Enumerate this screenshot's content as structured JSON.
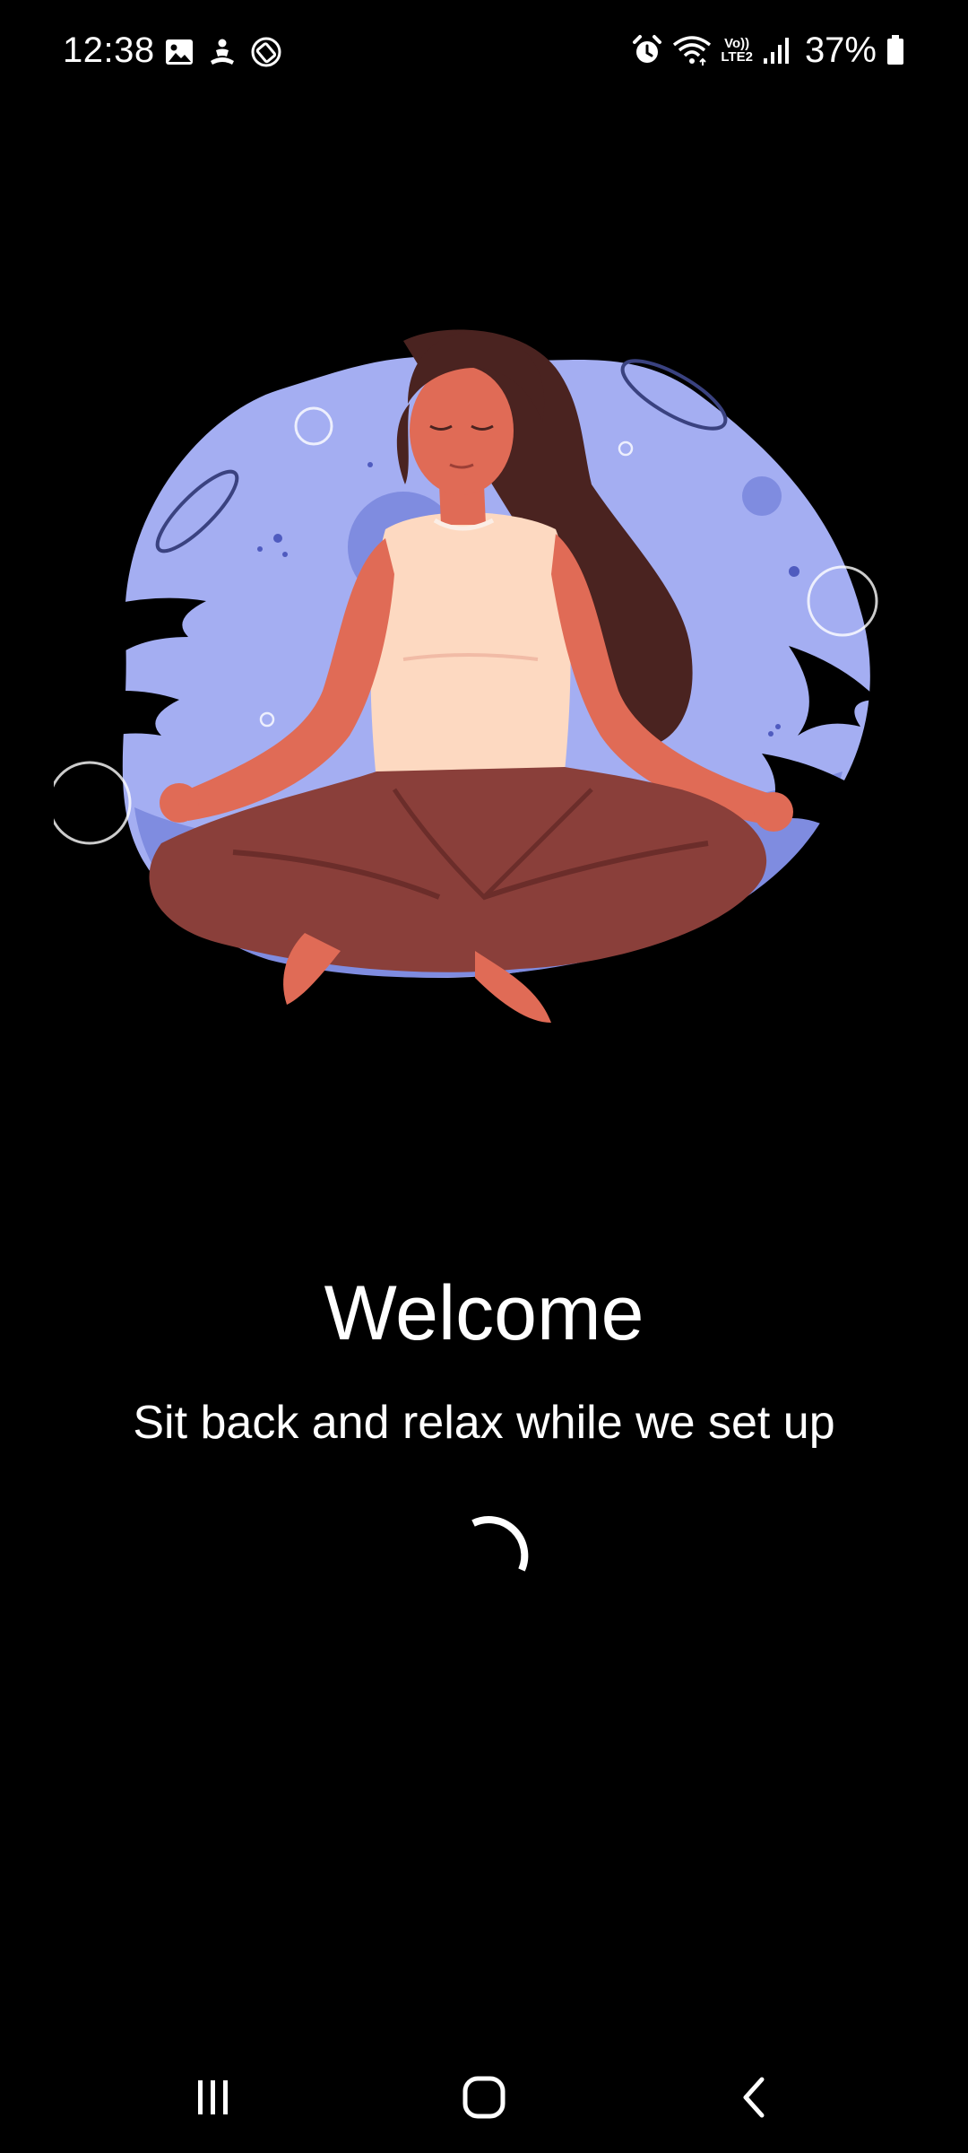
{
  "status_bar": {
    "time": "12:38",
    "left_icons": [
      "gallery-icon",
      "meditation-notification-icon",
      "screen-rotation-icon"
    ],
    "right_icons": [
      "alarm-icon",
      "wifi-icon",
      "volte-lte2-icon",
      "signal-icon",
      "battery-icon"
    ],
    "volte_label": "Vo))",
    "lte_label": "LTE2",
    "battery_percent": "37%",
    "battery_level": 0.37
  },
  "illustration": {
    "name": "meditating-woman-illustration",
    "colors": {
      "blob": "#a4aef2",
      "blob_shadow": "#7f8ce0",
      "skin": "#e06b56",
      "hair": "#4a2320",
      "top": "#fdd9c1",
      "pants": "#8a3f3a"
    }
  },
  "content": {
    "title": "Welcome",
    "subtitle": "Sit back and relax while we set up"
  },
  "nav_bar": {
    "buttons": [
      "recent-apps-button",
      "home-button",
      "back-button"
    ]
  }
}
